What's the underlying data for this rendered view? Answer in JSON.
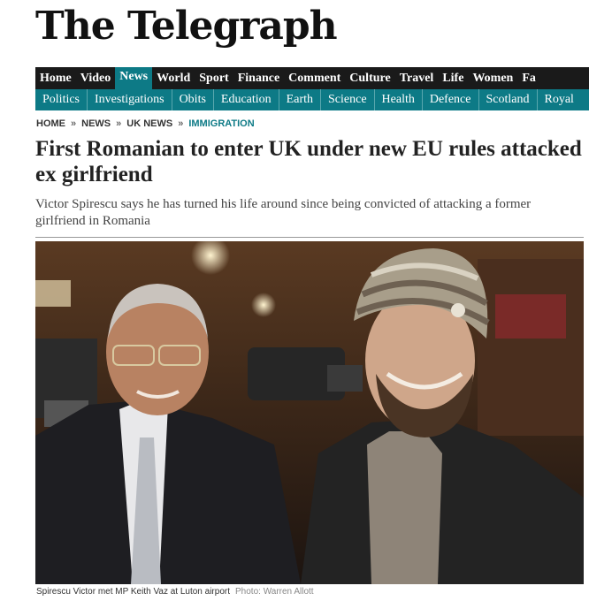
{
  "masthead": "The Telegraph",
  "nav_primary": [
    {
      "label": "Home"
    },
    {
      "label": "Video"
    },
    {
      "label": "News",
      "active": true
    },
    {
      "label": "World"
    },
    {
      "label": "Sport"
    },
    {
      "label": "Finance"
    },
    {
      "label": "Comment"
    },
    {
      "label": "Culture"
    },
    {
      "label": "Travel"
    },
    {
      "label": "Life"
    },
    {
      "label": "Women"
    },
    {
      "label": "Fa"
    }
  ],
  "nav_secondary": [
    "Politics",
    "Investigations",
    "Obits",
    "Education",
    "Earth",
    "Science",
    "Health",
    "Defence",
    "Scotland",
    "Royal"
  ],
  "breadcrumb": [
    "HOME",
    "NEWS",
    "UK NEWS",
    "IMMIGRATION"
  ],
  "article": {
    "headline": "First Romanian to enter UK under new EU rules attacked ex girlfriend",
    "standfirst": "Victor Spirescu says he has turned his life around since being convicted of attacking a former girlfriend in Romania",
    "caption": "Spirescu Victor met MP Keith Vaz at Luton airport",
    "credit": "Photo: Warren Allott"
  },
  "colors": {
    "nav_bg": "#1a1a1a",
    "accent": "#0d7a86"
  }
}
